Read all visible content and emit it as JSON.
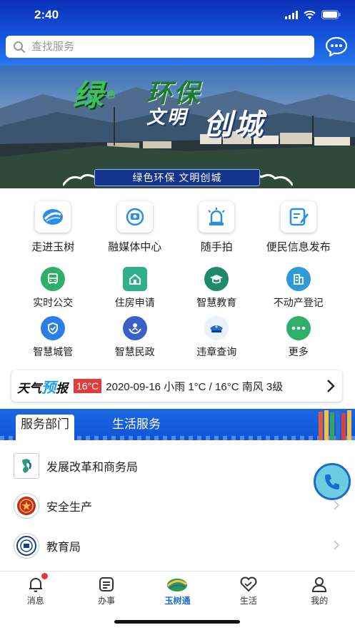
{
  "status_bar": {
    "time": "2:40"
  },
  "search": {
    "placeholder": "查找服务"
  },
  "banner": {
    "headline_1": "绿",
    "headline_small": "色",
    "headline_2": "环保",
    "headline_3": "文明",
    "headline_4": "创城",
    "caption": "绿色环保  文明创城"
  },
  "main_services": [
    {
      "label": "走进玉树",
      "icon": "yushu-logo-icon"
    },
    {
      "label": "融媒体中心",
      "icon": "media-center-icon"
    },
    {
      "label": "随手拍",
      "icon": "alarm-light-icon"
    },
    {
      "label": "便民信息发布",
      "icon": "edit-note-icon"
    }
  ],
  "services_row_1": [
    {
      "label": "实时公交",
      "icon": "bus-icon",
      "color": "#2fb06a"
    },
    {
      "label": "住房申请",
      "icon": "house-icon",
      "color": "#2fb08a"
    },
    {
      "label": "智慧教育",
      "icon": "graduation-cap-icon",
      "color": "#1f8a6a"
    },
    {
      "label": "不动产登记",
      "icon": "building-icon",
      "color": "#2f9ad8"
    }
  ],
  "services_row_2": [
    {
      "label": "智慧城管",
      "icon": "shield-icon",
      "color": "#2a7ee8"
    },
    {
      "label": "智慧民政",
      "icon": "people-hands-icon",
      "color": "#3a5fc8"
    },
    {
      "label": "违章查询",
      "icon": "police-cap-icon",
      "color": "#1f6fd6"
    },
    {
      "label": "更多",
      "icon": "more-dots-icon",
      "color": "#2fb06a"
    }
  ],
  "weather": {
    "logo_part1": "天气",
    "logo_highlight": "预",
    "logo_part2": "报",
    "temp_badge": "16°C",
    "summary": "2020-09-16 小雨 1°C / 16°C 南风 3级"
  },
  "tabs": {
    "active": "服务部门",
    "inactive": "生活服务"
  },
  "departments": [
    {
      "label": "发展改革和商务局",
      "logo": "development-bureau-logo-icon",
      "chevron": false
    },
    {
      "label": "安全生产",
      "logo": "safety-emblem-icon",
      "chevron": true
    },
    {
      "label": "教育局",
      "logo": "education-seal-icon",
      "chevron": true
    }
  ],
  "bottom_nav": [
    {
      "label": "消息",
      "icon": "bell-icon",
      "active": false,
      "badge": true
    },
    {
      "label": "办事",
      "icon": "document-icon",
      "active": false,
      "badge": false
    },
    {
      "label": "玉树通",
      "icon": "yushutong-logo-icon",
      "active": true,
      "badge": false
    },
    {
      "label": "生活",
      "icon": "heart-icon",
      "active": false,
      "badge": false
    },
    {
      "label": "我的",
      "icon": "person-icon",
      "active": false,
      "badge": false
    }
  ],
  "colors": {
    "primary": "#1558de",
    "accent_red": "#e23b3b",
    "weather_highlight": "#1aa3e8"
  }
}
